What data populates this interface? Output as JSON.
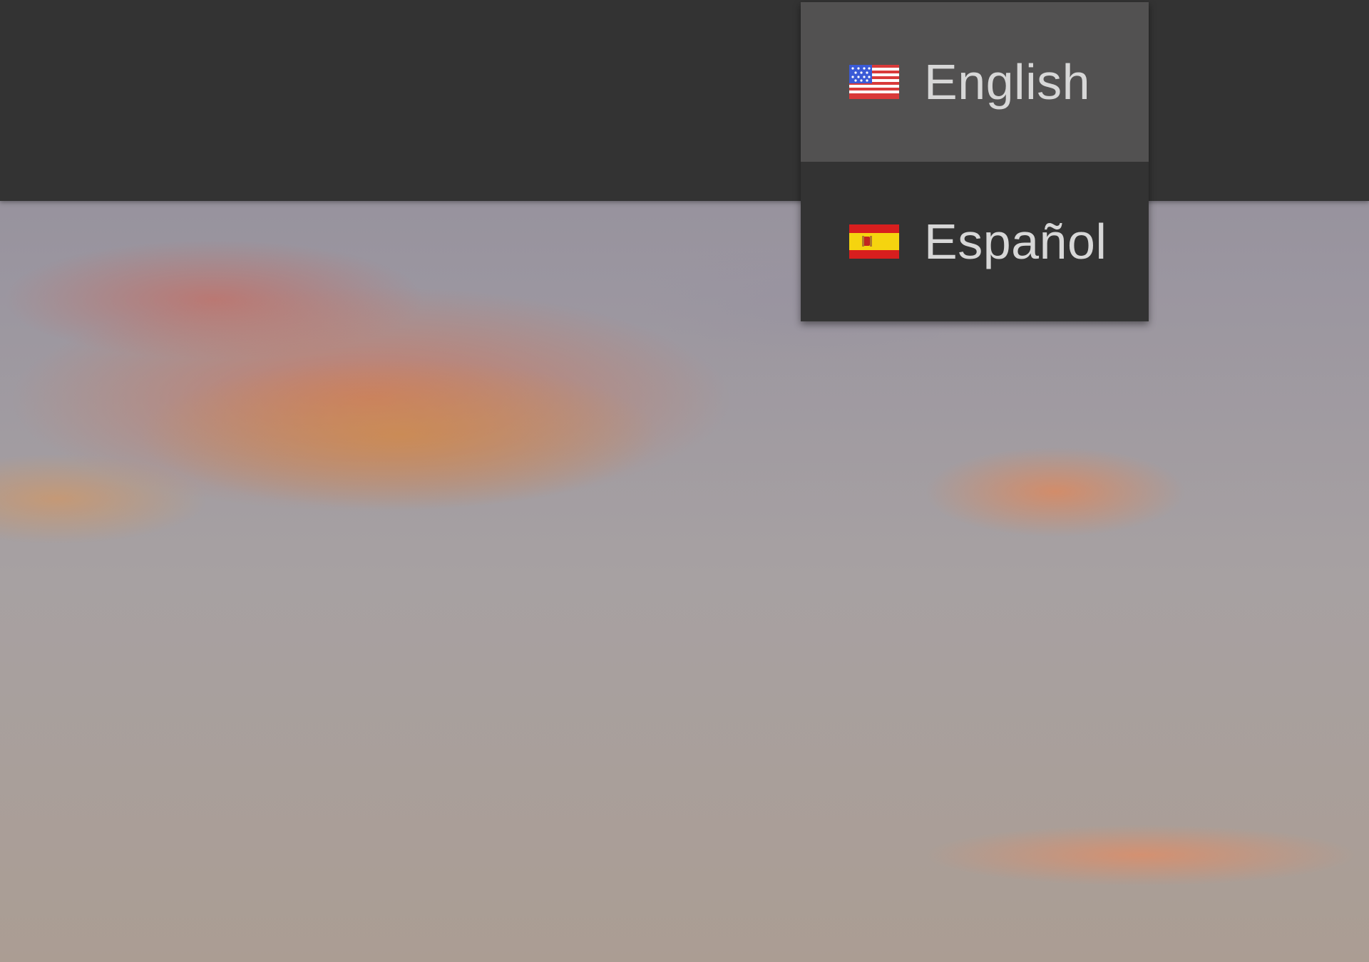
{
  "language_menu": {
    "items": [
      {
        "label": "English",
        "flag": "us-flag-icon",
        "selected": true
      },
      {
        "label": "Español",
        "flag": "spain-flag-icon",
        "selected": false
      }
    ]
  },
  "colors": {
    "topbar": "#333333",
    "menu_background": "#333333",
    "menu_selected": "#525151",
    "menu_text": "#d7d7d7"
  }
}
